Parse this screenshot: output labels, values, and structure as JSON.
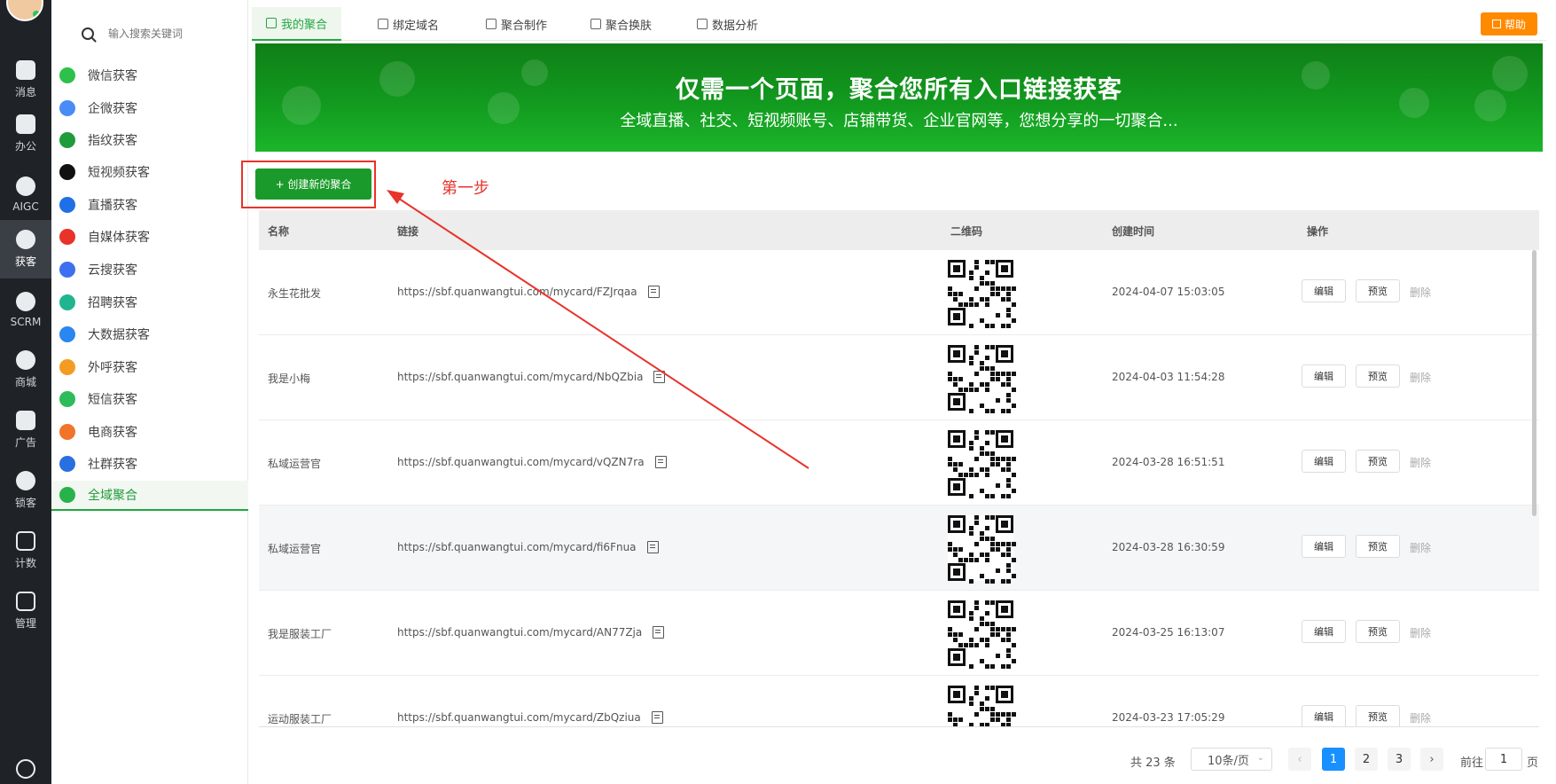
{
  "rail": {
    "items": [
      {
        "label": "消息",
        "icon": "message-icon"
      },
      {
        "label": "办公",
        "icon": "office-icon"
      },
      {
        "label": "AIGC",
        "icon": "aigc-icon"
      },
      {
        "label": "获客",
        "icon": "acquire-icon"
      },
      {
        "label": "SCRM",
        "icon": "scrm-icon"
      },
      {
        "label": "商城",
        "icon": "mall-icon"
      },
      {
        "label": "广告",
        "icon": "ads-icon"
      },
      {
        "label": "锁客",
        "icon": "lock-customer-icon"
      },
      {
        "label": "计数",
        "icon": "count-icon"
      },
      {
        "label": "管理",
        "icon": "manage-icon"
      }
    ],
    "active": "获客",
    "bottom_icon": "yen-icon"
  },
  "menu": {
    "search_placeholder": "输入搜索关键词",
    "items": [
      {
        "label": "微信获客",
        "color": "#2dc14a"
      },
      {
        "label": "企微获客",
        "color": "#4a8cf6"
      },
      {
        "label": "指纹获客",
        "color": "#1f9b3a"
      },
      {
        "label": "短视频获客",
        "color": "#111111"
      },
      {
        "label": "直播获客",
        "color": "#1f6fe6"
      },
      {
        "label": "自媒体获客",
        "color": "#e8332a"
      },
      {
        "label": "云搜获客",
        "color": "#3e6ff0"
      },
      {
        "label": "招聘获客",
        "color": "#1fb58f"
      },
      {
        "label": "大数据获客",
        "color": "#2a86f0"
      },
      {
        "label": "外呼获客",
        "color": "#f39c24"
      },
      {
        "label": "短信获客",
        "color": "#2dbb5c"
      },
      {
        "label": "电商获客",
        "color": "#f2732a"
      },
      {
        "label": "社群获客",
        "color": "#2a6fe0"
      },
      {
        "label": "全域聚合",
        "color": "#28b34a"
      }
    ],
    "active": "全域聚合"
  },
  "tabs": {
    "items": [
      "我的聚合",
      "绑定域名",
      "聚合制作",
      "聚合换肤",
      "数据分析"
    ],
    "active": "我的聚合",
    "help": "帮助"
  },
  "banner": {
    "title": "仅需一个页面，聚合您所有入口链接获客",
    "subtitle": "全域直播、社交、短视频账号、店铺带货、企业官网等，您想分享的一切聚合..."
  },
  "create_button": "+ 创建新的聚合",
  "annotation": "第一步",
  "table": {
    "headers": [
      "名称",
      "链接",
      "二维码",
      "创建时间",
      "操作"
    ],
    "rows": [
      {
        "name": "永生花批发",
        "link": "https://sbf.quanwangtui.com/mycard/FZJrqaa",
        "time": "2024-04-07 15:03:05"
      },
      {
        "name": "我是小梅",
        "link": "https://sbf.quanwangtui.com/mycard/NbQZbia",
        "time": "2024-04-03 11:54:28"
      },
      {
        "name": "私域运营官",
        "link": "https://sbf.quanwangtui.com/mycard/vQZN7ra",
        "time": "2024-03-28 16:51:51"
      },
      {
        "name": "私域运营官",
        "link": "https://sbf.quanwangtui.com/mycard/fi6Fnua",
        "time": "2024-03-28 16:30:59"
      },
      {
        "name": "我是服装工厂",
        "link": "https://sbf.quanwangtui.com/mycard/AN77Zja",
        "time": "2024-03-25 16:13:07"
      },
      {
        "name": "运动服装工厂",
        "link": "https://sbf.quanwangtui.com/mycard/ZbQziua",
        "time": "2024-03-23 17:05:29"
      }
    ],
    "actions": {
      "edit": "编辑",
      "preview": "预览",
      "delete": "删除"
    }
  },
  "pager": {
    "total": "共 23 条",
    "page_size": "10条/页",
    "pages": [
      "1",
      "2",
      "3"
    ],
    "current": "1",
    "goto_prefix": "前往",
    "goto_value": "1",
    "goto_suffix": "页"
  },
  "colors": {
    "primary": "#1a9a2a",
    "annotation": "#e8332a",
    "help": "#ff8a00",
    "pager_active": "#1890ff"
  }
}
